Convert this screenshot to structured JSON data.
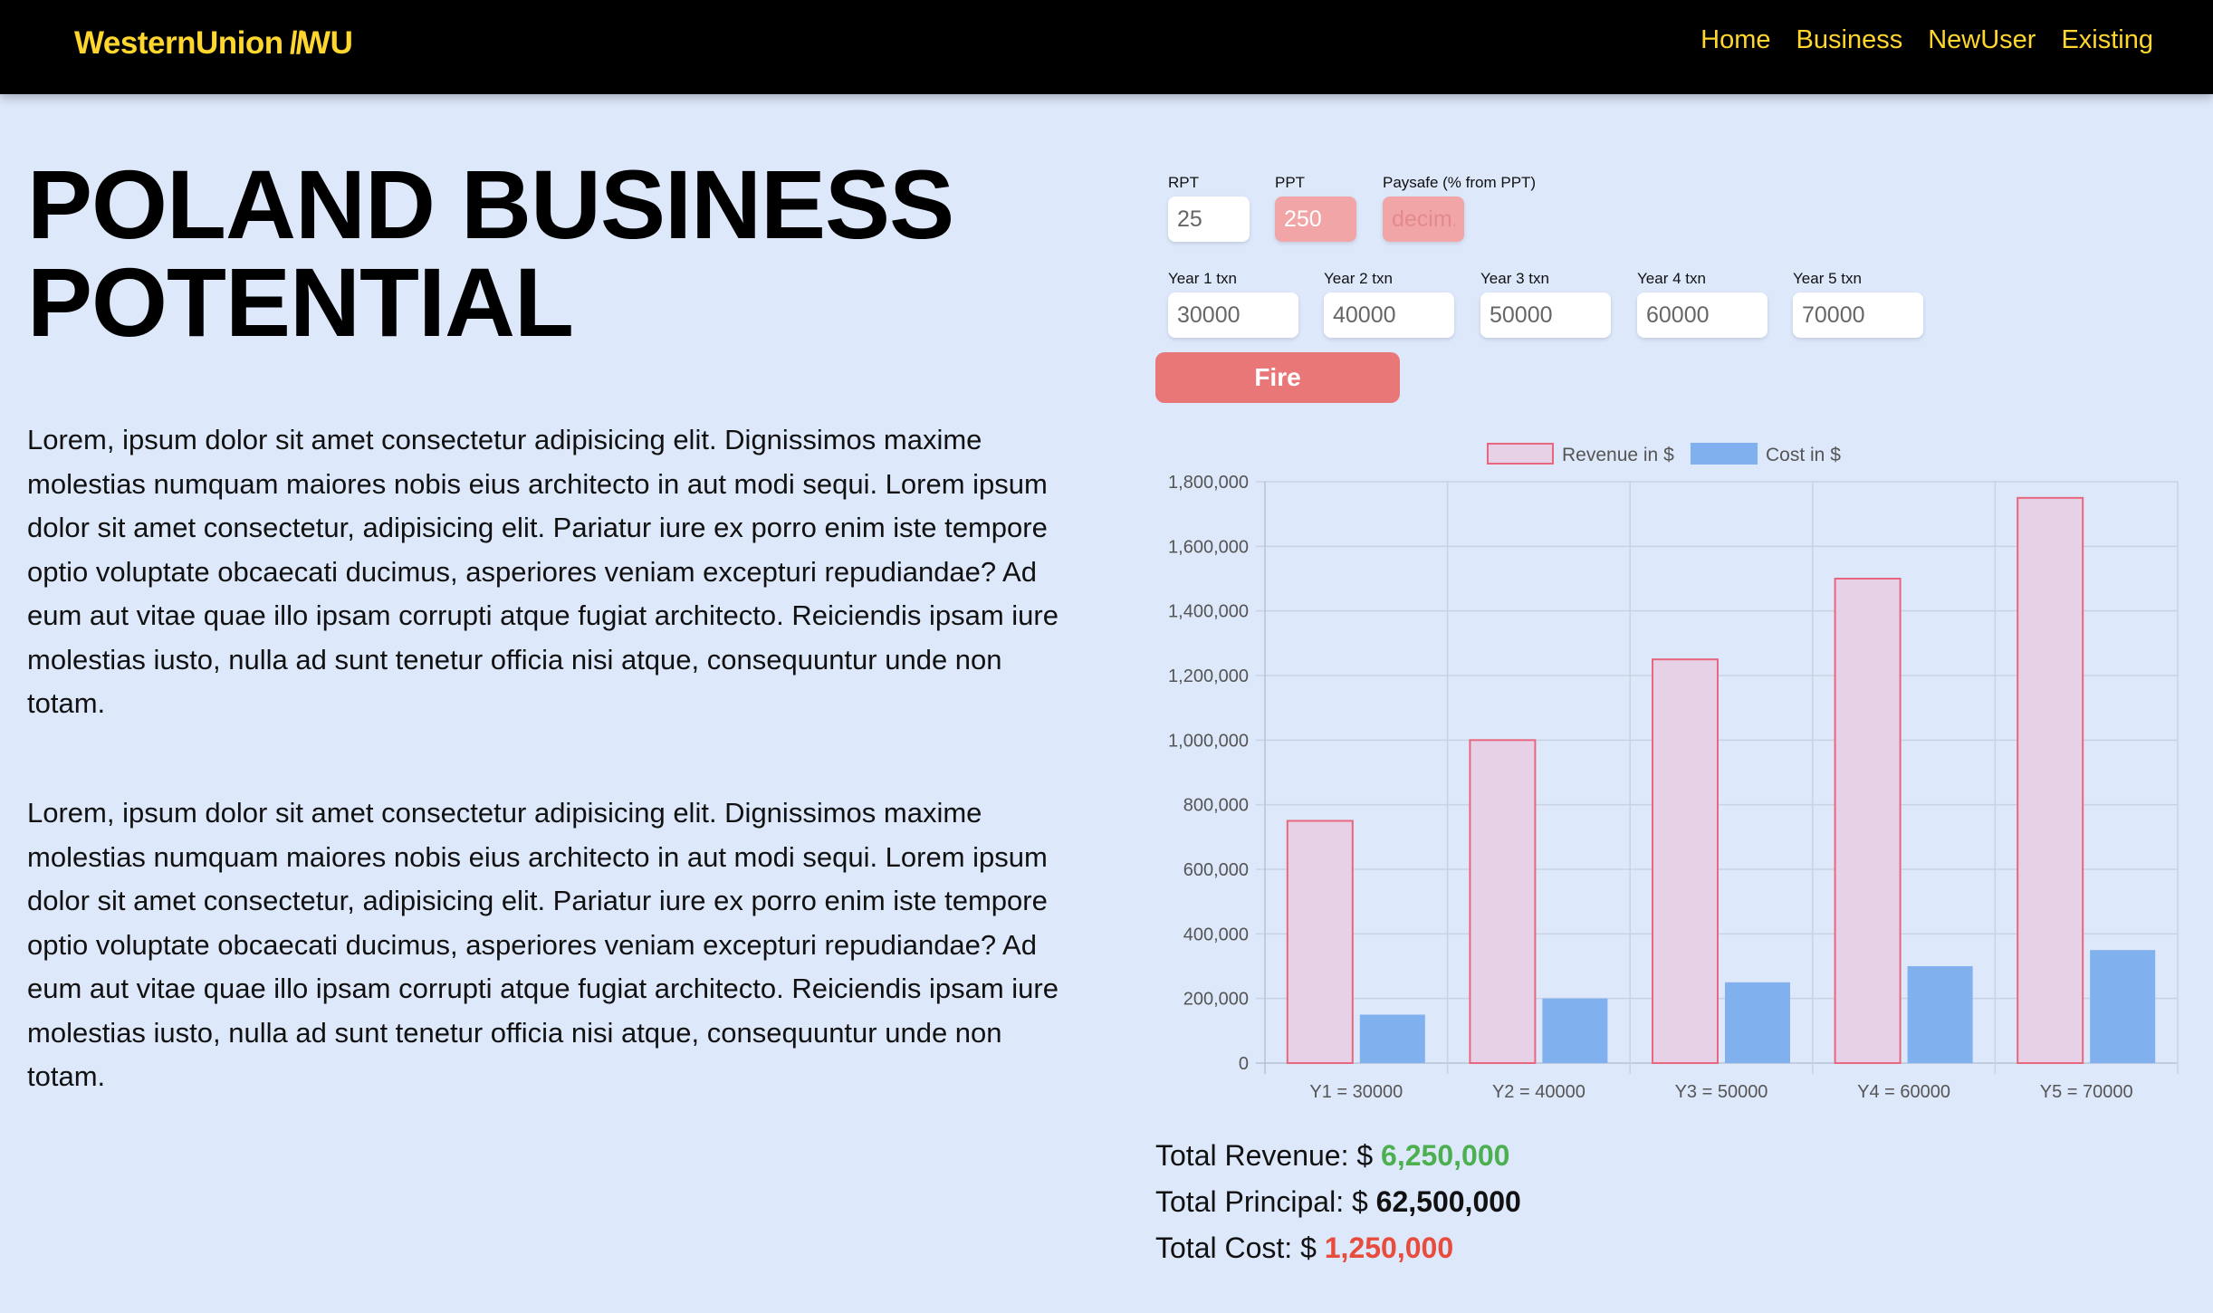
{
  "brand": {
    "name": "WesternUnion",
    "slashes": "\\\\",
    "mark": "WU",
    "color": "#ffd62e"
  },
  "nav": {
    "links": [
      "Home",
      "Business",
      "NewUser",
      "Existing"
    ]
  },
  "page": {
    "title_line1": "POLAND BUSINESS",
    "title_line2": "POTENTIAL",
    "paragraphs": [
      "Lorem, ipsum dolor sit amet consectetur adipisicing elit. Dignissimos maxime molestias numquam maiores nobis eius architecto in aut modi sequi. Lorem ipsum dolor sit amet consectetur, adipisicing elit. Pariatur iure ex porro enim iste tempore optio voluptate obcaecati ducimus, asperiores veniam excepturi repudiandae? Ad eum aut vitae quae illo ipsam corrupti atque fugiat architecto. Reiciendis ipsam iure molestias iusto, nulla ad sunt tenetur officia nisi atque, consequuntur unde non totam.",
      "Lorem, ipsum dolor sit amet consectetur adipisicing elit. Dignissimos maxime molestias numquam maiores nobis eius architecto in aut modi sequi. Lorem ipsum dolor sit amet consectetur, adipisicing elit. Pariatur iure ex porro enim iste tempore optio voluptate obcaecati ducimus, asperiores veniam excepturi repudiandae? Ad eum aut vitae quae illo ipsam corrupti atque fugiat architecto. Reiciendis ipsam iure molestias iusto, nulla ad sunt tenetur officia nisi atque, consequuntur unde non totam."
    ]
  },
  "form": {
    "rpt": {
      "label": "RPT",
      "value": "25"
    },
    "ppt": {
      "label": "PPT",
      "value": "250"
    },
    "paysafe": {
      "label": "Paysafe (% from PPT)",
      "placeholder": "decim."
    },
    "years": [
      {
        "label": "Year 1 txn",
        "value": "30000"
      },
      {
        "label": "Year 2 txn",
        "value": "40000"
      },
      {
        "label": "Year 3 txn",
        "value": "50000"
      },
      {
        "label": "Year 4 txn",
        "value": "60000"
      },
      {
        "label": "Year 5 txn",
        "value": "70000"
      }
    ],
    "fire_label": "Fire"
  },
  "chart_data": {
    "type": "bar",
    "categories": [
      "Y1 = 30000",
      "Y2 = 40000",
      "Y3 = 50000",
      "Y4 = 60000",
      "Y5 = 70000"
    ],
    "series": [
      {
        "name": "Revenue in $",
        "values": [
          750000,
          1000000,
          1250000,
          1500000,
          1750000
        ],
        "fill": "#e6d1e6",
        "stroke": "#e8677f"
      },
      {
        "name": "Cost in $",
        "values": [
          150000,
          200000,
          250000,
          300000,
          350000
        ],
        "fill": "#80b0ee",
        "stroke": "#80b0ee"
      }
    ],
    "ylim": [
      0,
      1800000
    ],
    "yticks": [
      "0",
      "200,000",
      "400,000",
      "600,000",
      "800,000",
      "1,000,000",
      "1,200,000",
      "1,400,000",
      "1,600,000",
      "1,800,000"
    ],
    "legend": "top-center",
    "grid": true
  },
  "totals": {
    "revenue_label": "Total Revenue: $ ",
    "revenue_value": "6,250,000",
    "revenue_color": "#4caf50",
    "principal_label": "Total Principal: $ ",
    "principal_value": "62,500,000",
    "cost_label": "Total Cost: $ ",
    "cost_value": "1,250,000",
    "cost_color": "#e74c3c"
  }
}
